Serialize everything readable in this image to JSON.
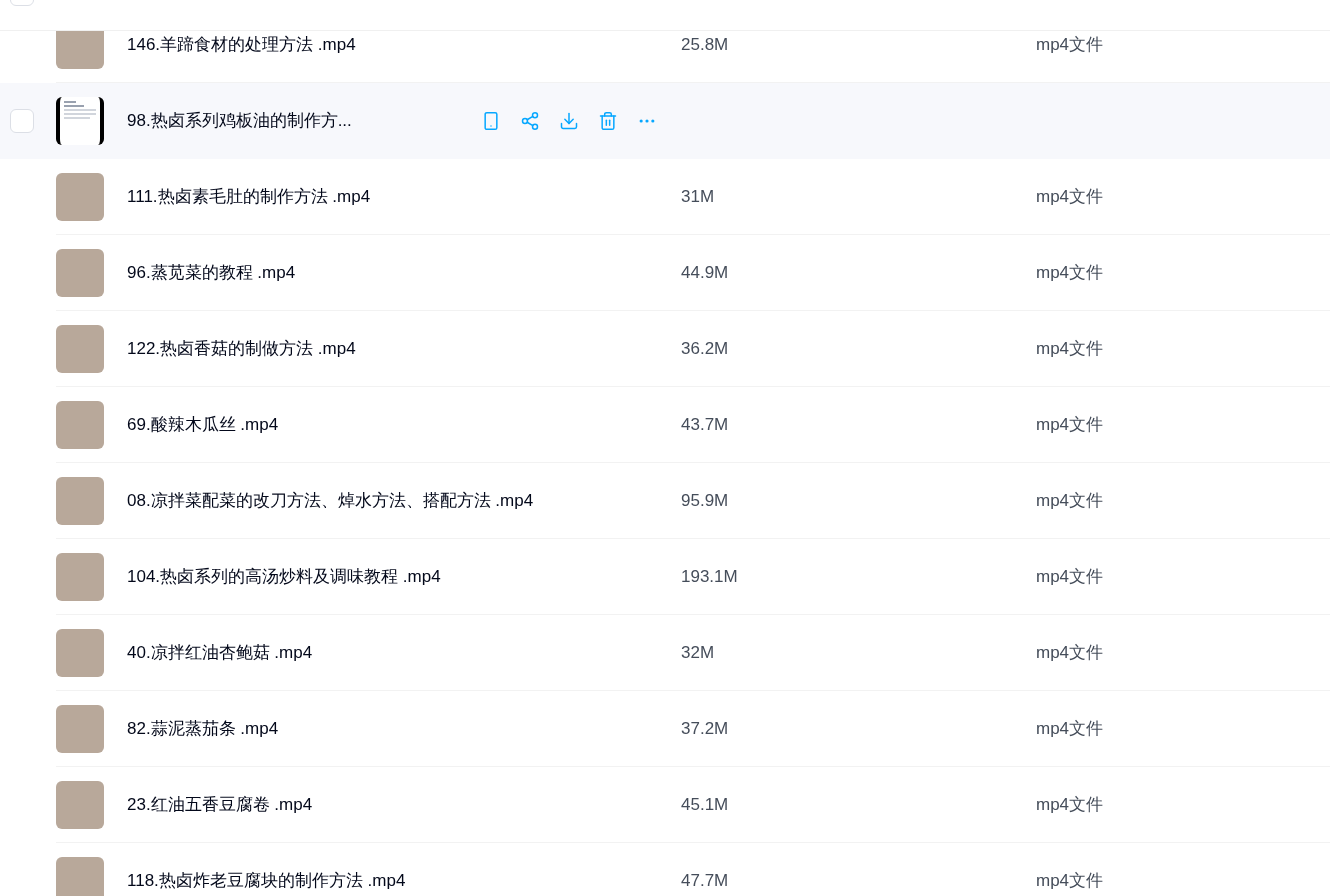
{
  "file_list": {
    "header": {
      "select_all_checked": false
    },
    "rows": [
      {
        "name": "146.羊蹄食材的处理方法 .mp4",
        "size": "25.8M",
        "type": "mp4文件",
        "kind": "photo",
        "hovered": false
      },
      {
        "name": "98.热卤系列鸡板油的制作方...",
        "kind": "document",
        "hovered": true,
        "checked": false
      },
      {
        "name": "111.热卤素毛肚的制作方法 .mp4",
        "size": "31M",
        "type": "mp4文件",
        "kind": "photo",
        "hovered": false
      },
      {
        "name": "96.蒸苋菜的教程 .mp4",
        "size": "44.9M",
        "type": "mp4文件",
        "kind": "photo",
        "hovered": false
      },
      {
        "name": "122.热卤香菇的制做方法 .mp4",
        "size": "36.2M",
        "type": "mp4文件",
        "kind": "photo",
        "hovered": false
      },
      {
        "name": "69.酸辣木瓜丝 .mp4",
        "size": "43.7M",
        "type": "mp4文件",
        "kind": "photo",
        "hovered": false
      },
      {
        "name": "08.凉拌菜配菜的改刀方法、焯水方法、搭配方法 .mp4",
        "size": "95.9M",
        "type": "mp4文件",
        "kind": "photo",
        "hovered": false
      },
      {
        "name": "104.热卤系列的高汤炒料及调味教程 .mp4",
        "size": "193.1M",
        "type": "mp4文件",
        "kind": "photo",
        "hovered": false
      },
      {
        "name": "40.凉拌红油杏鲍菇 .mp4",
        "size": "32M",
        "type": "mp4文件",
        "kind": "photo",
        "hovered": false
      },
      {
        "name": "82.蒜泥蒸茄条 .mp4",
        "size": "37.2M",
        "type": "mp4文件",
        "kind": "photo",
        "hovered": false
      },
      {
        "name": "23.红油五香豆腐卷 .mp4",
        "size": "45.1M",
        "type": "mp4文件",
        "kind": "photo",
        "hovered": false
      },
      {
        "name": "118.热卤炸老豆腐块的制作方法 .mp4",
        "size": "47.7M",
        "type": "mp4文件",
        "kind": "photo",
        "hovered": false
      }
    ]
  }
}
